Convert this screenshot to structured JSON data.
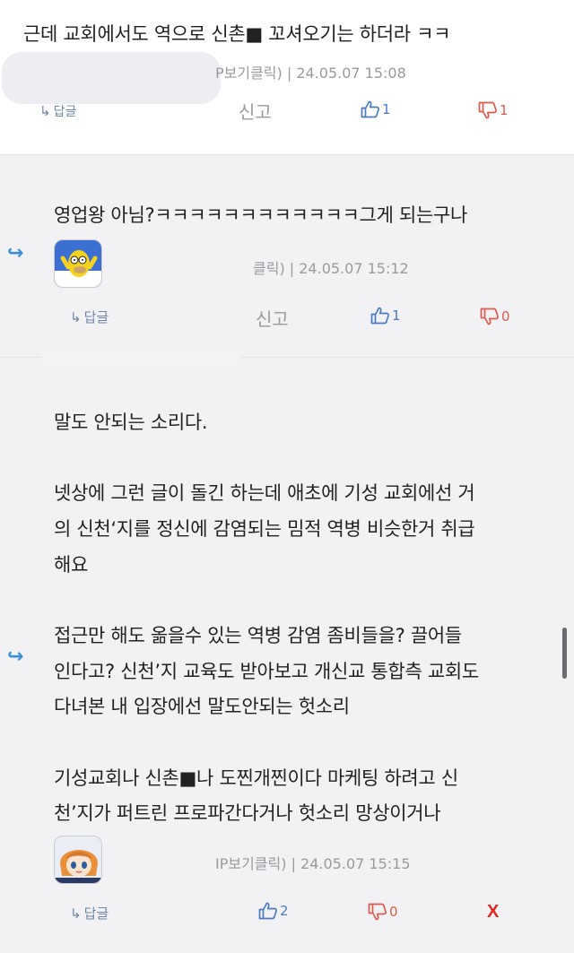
{
  "comments": [
    {
      "text_lines": [
        "근데 교회에서도 역으로 신촌■ 꼬셔오기는 하더라 ㅋㅋ"
      ],
      "meta": "P보기클릭) | 24.05.07 15:08",
      "reply_label": "답글",
      "report_label": "신고",
      "upvotes": "1",
      "downvotes": "1"
    },
    {
      "text_lines": [
        "영업왕 아님?ㅋㅋㅋㅋㅋㅋㅋㅋㅋㅋㅋㅋ그게 되는구나"
      ],
      "meta": "클릭) | 24.05.07 15:12",
      "reply_label": "답글",
      "report_label": "신고",
      "upvotes": "1",
      "downvotes": "0"
    },
    {
      "text_lines": [
        "말도 안되는 소리다.",
        "",
        "넷상에 그런 글이 돌긴 하는데 애초에 기성 교회에선 거",
        "의 신천‘지를 정신에 감염되는 밈적 역병 비슷한거 취급",
        "해요",
        "",
        "접근만 해도 옮을수 있는 역병 감염 좀비들을? 끌어들",
        "인다고? 신천’지 교육도 받아보고 개신교 통합측 교회도",
        "다녀본 내 입장에선 말도안되는 헛소리",
        "",
        "기성교회나 신촌■나 도찐개찐이다 마케팅 하려고 신",
        "천’지가 퍼트린 프로파간다거나 헛소리 망상이거나"
      ],
      "meta": "IP보기클릭) | 24.05.07 15:15",
      "reply_label": "답글",
      "upvotes": "2",
      "downvotes": "0",
      "delete_label": "X"
    }
  ],
  "colors": {
    "reply_arrow": "#3b8fd9",
    "upvote": "#4a7cc6",
    "downvote": "#de5a4e",
    "delete": "#e0281f"
  },
  "icons": {
    "reply": "reply-arrow-icon",
    "up": "thumbs-up-icon",
    "down": "thumbs-down-icon"
  }
}
